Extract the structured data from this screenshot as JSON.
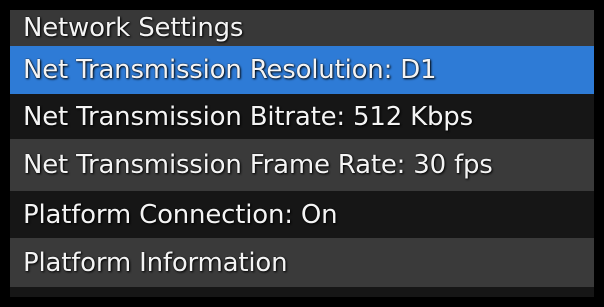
{
  "menu": {
    "title": "Network Settings",
    "items": [
      {
        "label": "Net Transmission Resolution: D1",
        "selected": true
      },
      {
        "label": "Net Transmission Bitrate: 512 Kbps",
        "selected": false
      },
      {
        "label": "Net Transmission Frame Rate: 30 fps",
        "selected": false
      },
      {
        "label": "Platform Connection: On",
        "selected": false
      },
      {
        "label": "Platform Information",
        "selected": false
      }
    ]
  },
  "colors": {
    "background": "#000000",
    "panel": "#161616",
    "header": "#383838",
    "row_alt": "#3a3a3a",
    "selected": "#2e7bd6",
    "text": "#f4f4f4"
  }
}
